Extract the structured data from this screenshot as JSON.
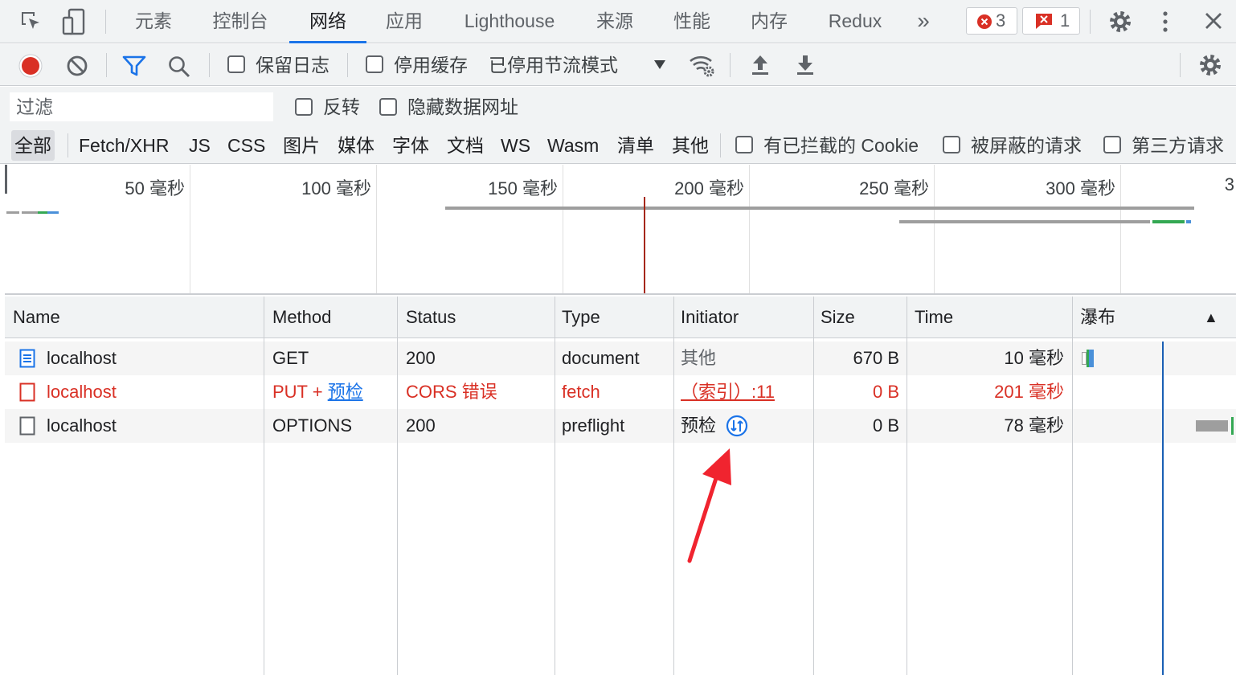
{
  "tabs": [
    {
      "label": "元素"
    },
    {
      "label": "控制台"
    },
    {
      "label": "网络",
      "active": true
    },
    {
      "label": "应用"
    },
    {
      "label": "Lighthouse"
    },
    {
      "label": "来源"
    },
    {
      "label": "性能"
    },
    {
      "label": "内存"
    },
    {
      "label": "Redux"
    }
  ],
  "more_tabs": "»",
  "error_count": "3",
  "issue_count": "1",
  "toolbar": {
    "preserve_log": "保留日志",
    "disable_cache": "停用缓存",
    "throttle": "已停用节流模式"
  },
  "filter": {
    "placeholder": "过滤",
    "invert": "反转",
    "hide_data_urls": "隐藏数据网址"
  },
  "types": [
    {
      "label": "全部",
      "active": true
    },
    {
      "label": "Fetch/XHR"
    },
    {
      "label": "JS"
    },
    {
      "label": "CSS"
    },
    {
      "label": "图片"
    },
    {
      "label": "媒体"
    },
    {
      "label": "字体"
    },
    {
      "label": "文档"
    },
    {
      "label": "WS"
    },
    {
      "label": "Wasm"
    },
    {
      "label": "清单"
    },
    {
      "label": "其他"
    }
  ],
  "type_checks": {
    "blocked_cookies": "有已拦截的 Cookie",
    "blocked_requests": "被屏蔽的请求",
    "third_party": "第三方请求"
  },
  "overview_ticks": [
    "50 毫秒",
    "100 毫秒",
    "150 毫秒",
    "200 毫秒",
    "250 毫秒",
    "300 毫秒",
    "3"
  ],
  "columns": {
    "name": "Name",
    "method": "Method",
    "status": "Status",
    "type": "Type",
    "initiator": "Initiator",
    "size": "Size",
    "time": "Time",
    "waterfall": "瀑布",
    "sort_icon": "▲"
  },
  "rows": [
    {
      "name": "localhost",
      "method": "GET",
      "status": "200",
      "type": "document",
      "initiator": "其他",
      "size": "670 B",
      "time": "10 毫秒"
    },
    {
      "name": "localhost",
      "method": "PUT + ",
      "method_link": "预检",
      "status": "CORS 错误",
      "type": "fetch",
      "initiator": "（索引）:11",
      "size": "0 B",
      "time": "201 毫秒",
      "error": true
    },
    {
      "name": "localhost",
      "method": "OPTIONS",
      "status": "200",
      "type": "preflight",
      "initiator": "预检",
      "size": "0 B",
      "time": "78 毫秒"
    }
  ],
  "colors": {
    "accent": "#1a73e8",
    "error": "#d93025",
    "record": "#d93025",
    "arrow": "#f0242f"
  }
}
